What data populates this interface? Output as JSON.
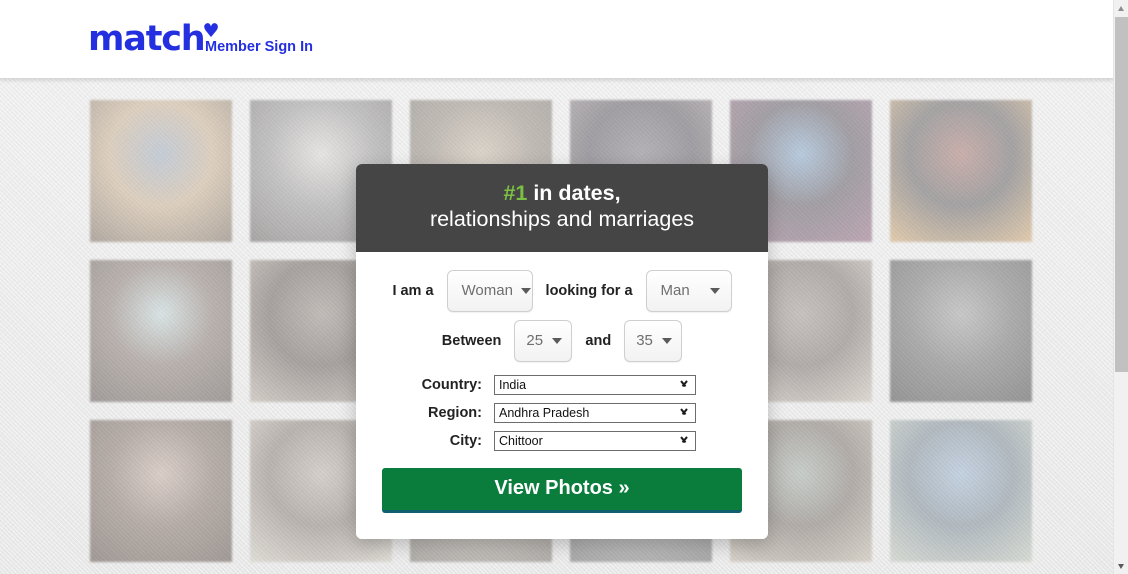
{
  "header": {
    "logo_text": "match",
    "logo_heart": "♥",
    "signin_label": "Member Sign In"
  },
  "promo": {
    "headline_number": "#1",
    "headline_line1_rest": " in dates,",
    "headline_line2": "relationships and marriages",
    "number_color": "#7bc043",
    "head_bg": "#454545"
  },
  "form": {
    "label_i_am_a": "I am a",
    "gender_self_value": "Woman",
    "label_looking_for_a": "looking for a",
    "gender_seek_value": "Man",
    "label_between": "Between",
    "age_min_value": "25",
    "label_and": "and",
    "age_max_value": "35",
    "label_country": "Country:",
    "country_value": "India",
    "label_region": "Region:",
    "region_value": "Andhra Pradesh",
    "label_city": "City:",
    "city_value": "Chittoor",
    "cta_label": "View Photos »",
    "cta_color": "#0a7c3c"
  },
  "collage": {
    "photo_alt_labels": [
      "profile-photo-man-blazer",
      "profile-photo-man-glasses",
      "profile-photo-indoor-scene",
      "profile-photo-man-cap",
      "profile-photo-man-blue-bg",
      "profile-photo-man-lamp",
      "profile-photo-woman-teal",
      "profile-photo-man-beard",
      "profile-photo-blurred-face",
      "profile-photo-woman-window",
      "profile-photo-woman-glasses",
      "profile-photo-woman-bw",
      "profile-photo-woman-closeup",
      "profile-photo-woman-with-dog",
      "profile-photo-person-light",
      "profile-photo-person-grey",
      "profile-photo-woman-saree",
      "profile-photo-man-striped-shirt"
    ]
  },
  "scrollbar": {
    "up_arrow": "scroll-up",
    "down_arrow": "scroll-down"
  }
}
